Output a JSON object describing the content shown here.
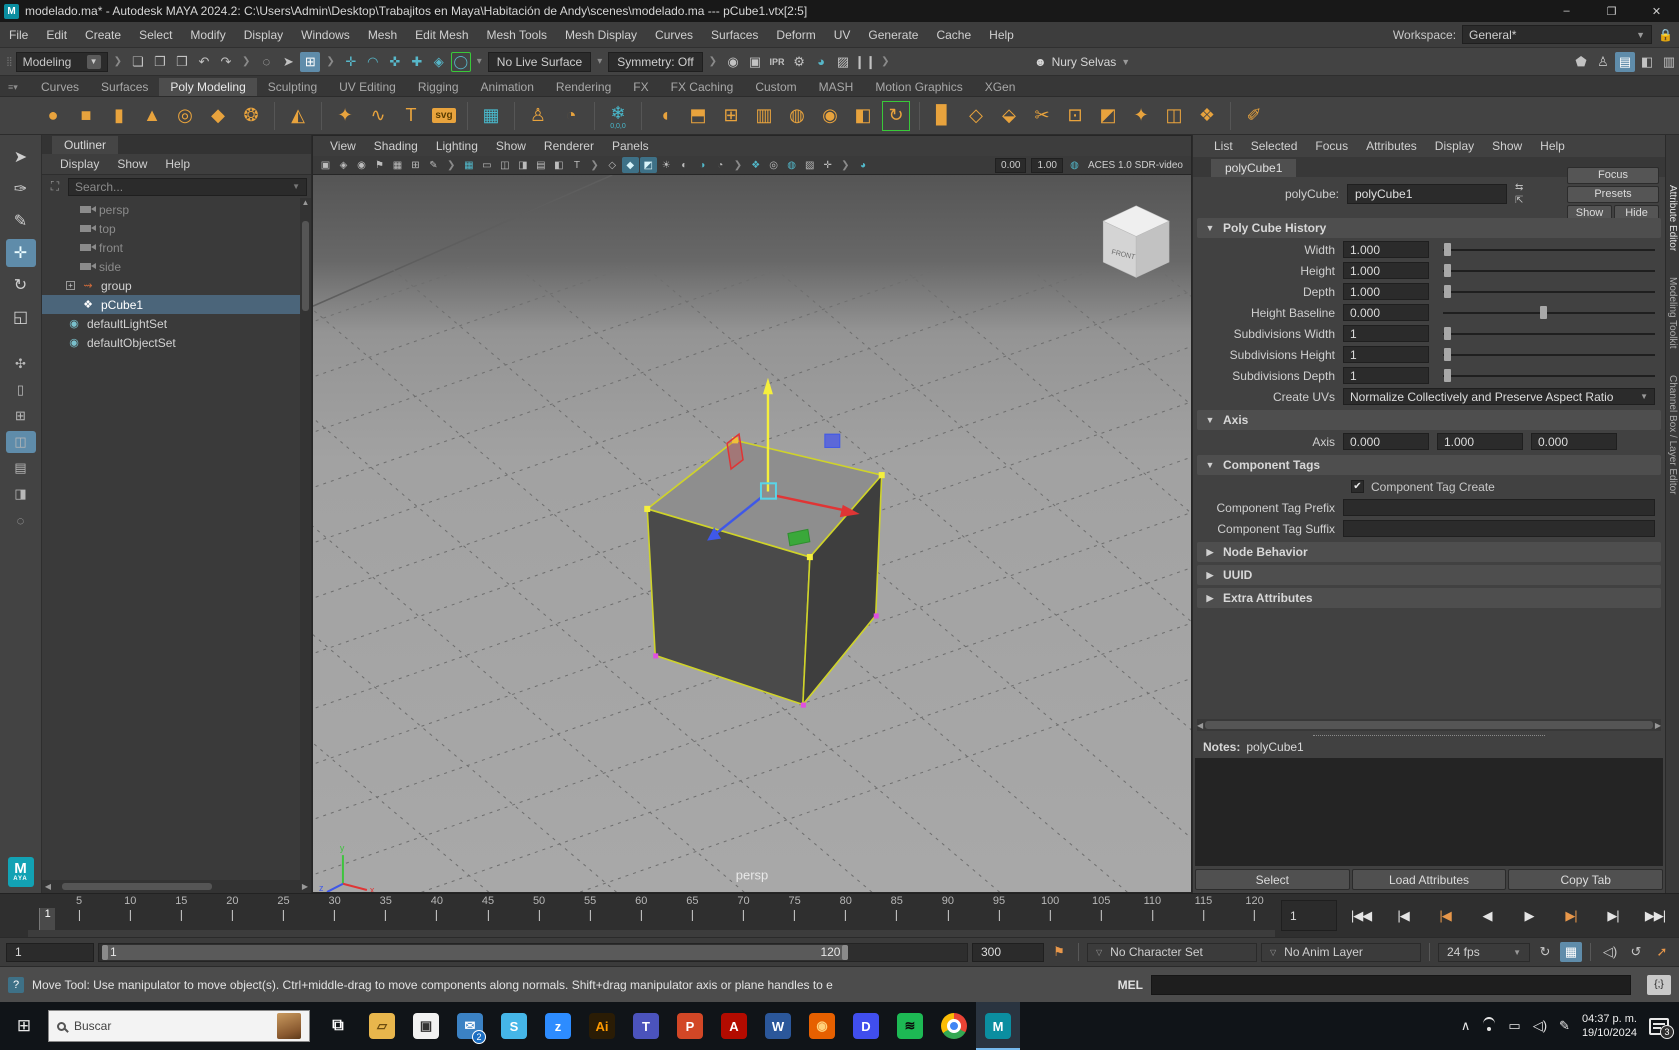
{
  "colors": {
    "accent_blue": "#5f8caa",
    "icon_orange": "#e8a33d",
    "maya_teal": "#0b8ea0",
    "selection_yellow": "#f5ef3d",
    "vertex_magenta": "#e050e0",
    "wire_green": "#cfd32a"
  },
  "window": {
    "title": "modelado.ma* - Autodesk MAYA 2024.2: C:\\Users\\Admin\\Desktop\\Trabajitos en Maya\\Habitación de Andy\\scenes\\modelado.ma   ---   pCube1.vtx[2:5]",
    "controls": {
      "minimize": "–",
      "maximize": "❐",
      "close": "✕"
    }
  },
  "menu_bar": {
    "items": [
      "File",
      "Edit",
      "Create",
      "Select",
      "Modify",
      "Display",
      "Windows",
      "Mesh",
      "Edit Mesh",
      "Mesh Tools",
      "Mesh Display",
      "Curves",
      "Surfaces",
      "Deform",
      "UV",
      "Generate",
      "Cache",
      "Help"
    ],
    "workspace_label": "Workspace:",
    "workspace_value": "General*"
  },
  "status_line": {
    "mode": "Modeling",
    "file_icons": [
      "new-scene-icon",
      "open-scene-icon",
      "save-scene-icon",
      "undo-icon",
      "redo-icon"
    ],
    "selection_icons": [
      "select-hierarchy-icon",
      "select-object-icon",
      "select-component-icon"
    ],
    "selection_active": "select-component-icon",
    "snap_icons": [
      "snap-grid-icon",
      "snap-curve-icon",
      "snap-point-icon",
      "snap-projected-center-icon",
      "snap-view-plane-icon",
      "make-live-icon"
    ],
    "live_surface": "No Live Surface",
    "symmetry": "Symmetry: Off",
    "render_icons": [
      "open-render-view-icon",
      "render-current-frame-icon",
      "ipr-render-icon",
      "render-settings-icon",
      "arnold-renderview-icon",
      "texture-bake-icon",
      "pause-viewport-icon"
    ],
    "user": "Nury Selvas",
    "panel_toggle_icons": [
      "modeling-toolkit-icon",
      "character-controls-icon",
      "attribute-editor-icon",
      "tool-settings-icon",
      "channel-box-icon"
    ],
    "panel_toggle_active": "attribute-editor-icon"
  },
  "shelf": {
    "tabs": [
      "Curves",
      "Surfaces",
      "Poly Modeling",
      "Sculpting",
      "UV Editing",
      "Rigging",
      "Animation",
      "Rendering",
      "FX",
      "FX Caching",
      "Custom",
      "MASH",
      "Motion Graphics",
      "XGen"
    ],
    "active_tab": "Poly Modeling",
    "icons": [
      "sphere-icon",
      "cube-icon",
      "cylinder-icon",
      "cone-icon",
      "torus-icon",
      "plane-icon",
      "disc-icon",
      "sep",
      "platonic-icon",
      "sep",
      "sweep-mesh-icon",
      "curve-warp-icon",
      "type-icon",
      "svg-icon",
      "sep",
      "modeling-toolkit-grid-icon",
      "sep",
      "character-icon",
      "time-icon",
      "sep",
      "softmod-icon",
      "sep",
      "booleans-icon",
      "combine-icon",
      "separate-icon",
      "extract-icon",
      "fill-hole-icon",
      "smooth-icon",
      "mirror-icon",
      "spin-edge-icon",
      "sep",
      "extrude-icon",
      "bevel-icon",
      "bridge-icon",
      "multicut-icon",
      "targetweld-icon",
      "quaddraw-icon",
      "crease-icon",
      "symmetrize-icon",
      "remesh-icon",
      "sep",
      "sculpt-icon"
    ],
    "softmod_label": "0,0,0"
  },
  "toolbox": {
    "tools": [
      "select-tool",
      "lasso-tool",
      "paint-select-tool",
      "move-tool",
      "rotate-tool",
      "scale-tool"
    ],
    "active_tool": "move-tool",
    "layouts": [
      "universal-manip-tool",
      "single-pane-layout",
      "four-pane-layout",
      "pane-outliner-layout",
      "split-pane-layout",
      "hypershade-layout"
    ],
    "active_layout": "pane-outliner-layout"
  },
  "outliner": {
    "tab": "Outliner",
    "menus": [
      "Display",
      "Show",
      "Help"
    ],
    "search_placeholder": "Search...",
    "items": [
      {
        "label": "persp",
        "icon": "camera-icon",
        "dimmed": true,
        "indent": 2
      },
      {
        "label": "top",
        "icon": "camera-icon",
        "dimmed": true,
        "indent": 2
      },
      {
        "label": "front",
        "icon": "camera-icon",
        "dimmed": true,
        "indent": 2
      },
      {
        "label": "side",
        "icon": "camera-icon",
        "dimmed": true,
        "indent": 2
      },
      {
        "label": "group",
        "icon": "transform-icon",
        "expander": true,
        "indent": 1
      },
      {
        "label": "pCube1",
        "icon": "mesh-icon",
        "selected": true,
        "indent": 2
      },
      {
        "label": "defaultLightSet",
        "icon": "light-set-icon",
        "indent": 1
      },
      {
        "label": "defaultObjectSet",
        "icon": "object-set-icon",
        "indent": 1
      }
    ]
  },
  "viewport": {
    "menus": [
      "View",
      "Shading",
      "Lighting",
      "Show",
      "Renderer",
      "Panels"
    ],
    "icon_names": [
      "select-camera-icon",
      "lock-camera-icon",
      "camera-attrs-icon",
      "bookmark-icon",
      "image-plane-icon",
      "2d-pan-zoom-icon",
      "grease-pencil-icon",
      "sep",
      "grid-icon",
      "film-gate-icon",
      "resolution-gate-icon",
      "gate-mask-icon",
      "field-chart-icon",
      "safe-action-icon",
      "safe-title-icon",
      "sep",
      "wireframe-icon",
      "shaded-icon",
      "textured-icon",
      "use-all-lights-icon",
      "shadows-icon",
      "ao-icon",
      "motion-blur-icon",
      "sep",
      "multisample-icon",
      "dof-icon",
      "isolate-select-icon",
      "xray-icon",
      "joint-xray-icon",
      "sep",
      "exposure-icon"
    ],
    "active_icons": [
      "shaded-icon",
      "textured-icon"
    ],
    "exposure_value": "0.00",
    "gamma_value": "1.00",
    "colorspace": "ACES 1.0 SDR-video",
    "camera_label": "persp",
    "viewcube_label": "FRONT",
    "axis_labels": {
      "x": "x",
      "y": "y",
      "z": "z"
    }
  },
  "attribute_editor": {
    "menus": [
      "List",
      "Selected",
      "Focus",
      "Attributes",
      "Display",
      "Show",
      "Help"
    ],
    "tab": "polyCube1",
    "node_type_label": "polyCube:",
    "node_name": "polyCube1",
    "buttons": {
      "focus": "Focus",
      "presets": "Presets",
      "show": "Show",
      "hide": "Hide"
    },
    "poly_cube_history": {
      "title": "Poly Cube History",
      "rows": [
        {
          "label": "Width",
          "value": "1.000",
          "slider": 0.02
        },
        {
          "label": "Height",
          "value": "1.000",
          "slider": 0.02
        },
        {
          "label": "Depth",
          "value": "1.000",
          "slider": 0.02
        },
        {
          "label": "Height Baseline",
          "value": "0.000",
          "slider": 0.47
        },
        {
          "label": "Subdivisions Width",
          "value": "1",
          "slider": 0.02
        },
        {
          "label": "Subdivisions Height",
          "value": "1",
          "slider": 0.02
        },
        {
          "label": "Subdivisions Depth",
          "value": "1",
          "slider": 0.02
        }
      ],
      "create_uvs_label": "Create UVs",
      "create_uvs_value": "Normalize Collectively and Preserve Aspect Ratio"
    },
    "axis_section": {
      "title": "Axis",
      "label": "Axis",
      "values": [
        "0.000",
        "1.000",
        "0.000"
      ]
    },
    "component_tags": {
      "title": "Component Tags",
      "checkbox_label": "Component Tag Create",
      "checked": true,
      "prefix_label": "Component Tag Prefix",
      "suffix_label": "Component Tag Suffix"
    },
    "collapsed_sections": [
      "Node Behavior",
      "UUID",
      "Extra Attributes"
    ],
    "notes_label": "Notes:",
    "notes_value": "polyCube1",
    "footer_buttons": [
      "Select",
      "Load Attributes",
      "Copy Tab"
    ]
  },
  "right_strip": {
    "tabs": [
      "Attribute Editor",
      "Modeling Toolkit",
      "Channel Box / Layer Editor"
    ],
    "active": "Attribute Editor"
  },
  "timeline": {
    "ticks": [
      5,
      10,
      15,
      20,
      25,
      30,
      35,
      40,
      45,
      50,
      55,
      60,
      65,
      70,
      75,
      80,
      85,
      90,
      95,
      100,
      105,
      110,
      115,
      120
    ],
    "current_frame": "1",
    "frame_field": "1",
    "playback": [
      {
        "name": "go-to-start-button",
        "glyph": "|◀◀"
      },
      {
        "name": "step-back-frame-button",
        "glyph": "|◀"
      },
      {
        "name": "step-back-key-button",
        "glyph": "|◀",
        "key": true
      },
      {
        "name": "play-backwards-button",
        "glyph": "◀"
      },
      {
        "name": "play-forwards-button",
        "glyph": "▶"
      },
      {
        "name": "step-forward-key-button",
        "glyph": "▶|",
        "key": true
      },
      {
        "name": "step-forward-frame-button",
        "glyph": "▶|"
      },
      {
        "name": "go-to-end-button",
        "glyph": "▶▶|"
      }
    ]
  },
  "range_slider": {
    "anim_start": "1",
    "range_start": "1",
    "range_end": "120",
    "anim_end": "300",
    "character_set": "No Character Set",
    "anim_layer": "No Anim Layer",
    "fps": "24 fps"
  },
  "help_line": {
    "text": "Move Tool: Use manipulator to move object(s). Ctrl+middle-drag to move components along normals. Shift+drag manipulator axis or plane handles to e",
    "mel_label": "MEL"
  },
  "taskbar": {
    "search_placeholder": "Buscar",
    "apps": [
      {
        "name": "task-view",
        "glyph": "⧉",
        "bg": "plain",
        "fg": "#ffffff"
      },
      {
        "name": "file-explorer",
        "glyph": "▱",
        "bg": "#e8b64c",
        "fg": "#6d4d10"
      },
      {
        "name": "microsoft-store",
        "glyph": "▣",
        "bg": "#f2f2f2",
        "fg": "#333333"
      },
      {
        "name": "mail",
        "glyph": "✉",
        "bg": "#3b82c4",
        "fg": "#ffffff",
        "badge": "2"
      },
      {
        "name": "skype",
        "glyph": "S",
        "bg": "#45b6e8",
        "fg": "#ffffff"
      },
      {
        "name": "zoom",
        "glyph": "z",
        "bg": "#2d8cff",
        "fg": "#ffffff"
      },
      {
        "name": "illustrator",
        "glyph": "Ai",
        "bg": "#2a1c05",
        "fg": "#ff9a00"
      },
      {
        "name": "teams",
        "glyph": "T",
        "bg": "#4b53bc",
        "fg": "#ffffff"
      },
      {
        "name": "powerpoint",
        "glyph": "P",
        "bg": "#d24726",
        "fg": "#ffffff"
      },
      {
        "name": "acrobat",
        "glyph": "A",
        "bg": "#b30b00",
        "fg": "#ffffff"
      },
      {
        "name": "word",
        "glyph": "W",
        "bg": "#2b579a",
        "fg": "#ffffff"
      },
      {
        "name": "firefox",
        "glyph": "◉",
        "bg": "#e66000",
        "fg": "#ffd27a"
      },
      {
        "name": "discord",
        "glyph": "D",
        "bg": "#404eed",
        "fg": "#ffffff"
      },
      {
        "name": "spotify",
        "glyph": "≋",
        "bg": "#1db954",
        "fg": "#0a0a0a"
      },
      {
        "name": "chrome",
        "glyph": "",
        "bg": "chrome"
      },
      {
        "name": "maya",
        "glyph": "M",
        "bg": "#0b8ea0",
        "fg": "#ffffff",
        "active": true
      }
    ],
    "time": "04:37 p. m.",
    "date": "19/10/2024",
    "notification_count": "3"
  }
}
